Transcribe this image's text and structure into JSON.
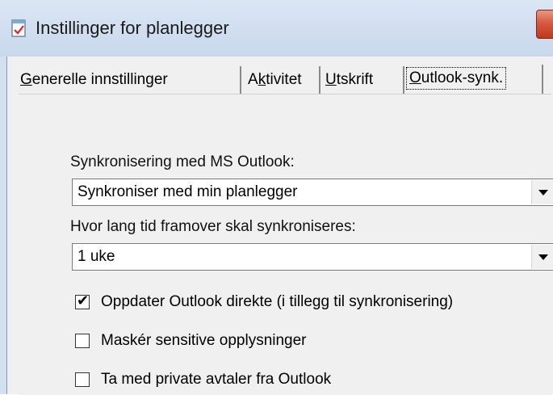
{
  "window": {
    "title": "Instillinger for planlegger"
  },
  "tabs": [
    {
      "label_underlined": "G",
      "label_rest": "enerelle innstillinger"
    },
    {
      "label_pre": "A",
      "label_underlined": "k",
      "label_rest": "tivitet"
    },
    {
      "label_underlined": "U",
      "label_rest": "tskrift"
    },
    {
      "label_underlined": "O",
      "label_rest": "utlook-synk."
    }
  ],
  "sync": {
    "label": "Synkronisering med MS Outlook:",
    "value": "Synkroniser med min planlegger"
  },
  "period": {
    "label": "Hvor lang tid framover skal synkroniseres:",
    "value": "1 uke"
  },
  "checks": [
    {
      "label": "Oppdater Outlook direkte (i tillegg til synkronisering)",
      "checked": true,
      "mark": "✔"
    },
    {
      "label": "Maskér sensitive opplysninger",
      "checked": false,
      "mark": ""
    },
    {
      "label": "Ta med private avtaler fra Outlook",
      "checked": false,
      "mark": ""
    }
  ]
}
